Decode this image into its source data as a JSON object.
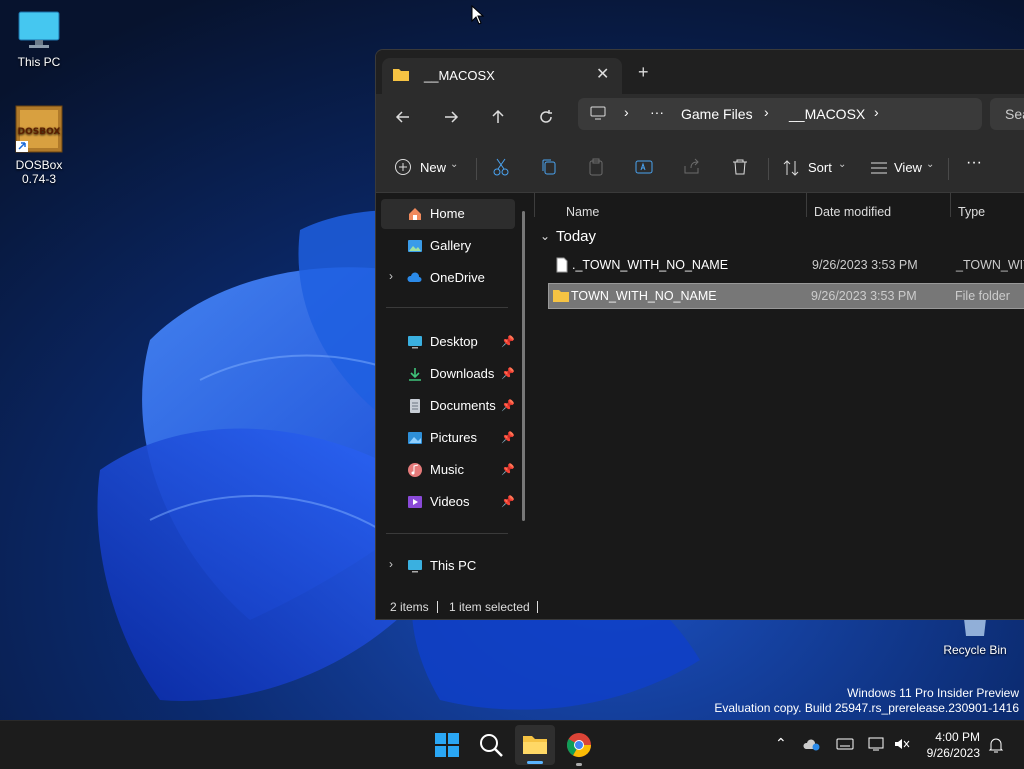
{
  "desktop": {
    "icons": [
      {
        "label": "This PC"
      },
      {
        "label": "DOSBox 0.74-3",
        "logo_text": "DOSBOX"
      },
      {
        "label": "Recycle Bin"
      }
    ],
    "watermark_line1": "Windows 11 Pro Insider Preview",
    "watermark_line2": "Evaluation copy. Build 25947.rs_prerelease.230901-1416"
  },
  "explorer": {
    "tab_title": "__MACOSX",
    "close_glyph": "✕",
    "new_tab_glyph": "+",
    "breadcrumb": [
      "Game Files",
      "__MACOSX"
    ],
    "breadcrumb_ellipsis": "···",
    "search_placeholder": "Sea",
    "commands": {
      "new": "New",
      "sort": "Sort",
      "view": "View",
      "more": "···"
    },
    "nav": {
      "home": "Home",
      "gallery": "Gallery",
      "onedrive": "OneDrive",
      "desktop": "Desktop",
      "downloads": "Downloads",
      "documents": "Documents",
      "pictures": "Pictures",
      "music": "Music",
      "videos": "Videos",
      "thispc": "This PC"
    },
    "columns": {
      "name": "Name",
      "date": "Date modified",
      "type": "Type"
    },
    "group_label": "Today",
    "files": [
      {
        "name": "._TOWN_WITH_NO_NAME",
        "date": "9/26/2023 3:53 PM",
        "type": "_TOWN_WIT",
        "selected": false
      },
      {
        "name": "TOWN_WITH_NO_NAME",
        "date": "9/26/2023 3:53 PM",
        "type": "File folder",
        "selected": true
      }
    ],
    "status": {
      "items": "2 items",
      "selected": "1 item selected"
    }
  },
  "taskbar": {
    "clock_time": "4:00 PM",
    "clock_date": "9/26/2023"
  },
  "colors": {
    "accent": "#0078d4",
    "folder": "#f6c343",
    "selection": "#777777"
  }
}
